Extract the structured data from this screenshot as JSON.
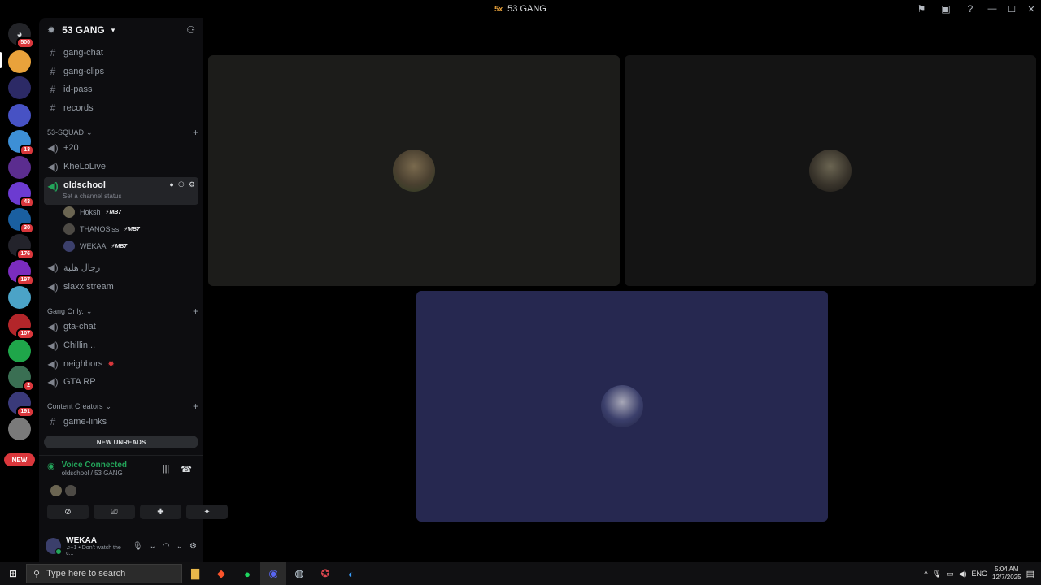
{
  "window": {
    "title": "53 GANG",
    "title_icon": "5x"
  },
  "rail": {
    "dm_badge": "500",
    "servers": [
      {
        "badge": "",
        "color": "#e9a23b"
      },
      {
        "badge": "",
        "color": "#2c2a66"
      },
      {
        "badge": "",
        "color": "#4752c4"
      },
      {
        "badge": "13",
        "color": "#3d8fd6"
      },
      {
        "badge": "",
        "color": "#5b2d8f"
      },
      {
        "badge": "43",
        "color": "#6c3bd1"
      },
      {
        "badge": "30",
        "color": "#1a5fa0"
      },
      {
        "badge": "176",
        "color": "#23232b"
      },
      {
        "badge": "197",
        "color": "#7b2cbf"
      },
      {
        "badge": "",
        "color": "#4ba3c7"
      },
      {
        "badge": "107",
        "color": "#b3262a"
      },
      {
        "badge": "",
        "color": "#1fa64a"
      },
      {
        "badge": "2",
        "color": "#3a6f53"
      },
      {
        "badge": "191",
        "color": "#3a3a7a"
      },
      {
        "badge": "",
        "color": "#7a7a7a"
      }
    ],
    "new_label": "NEW"
  },
  "sidebar": {
    "server_name": "53 GANG",
    "channels_top": [
      "gang-chat",
      "gang-clips",
      "id-pass",
      "records"
    ],
    "category_squad": "53-SQUAD",
    "squad_channels": [
      "+20",
      "KheLoLive"
    ],
    "active_channel": "oldschool",
    "active_status": "Set a channel status",
    "voice_users": [
      {
        "name": "Hoksh",
        "tag": "MB7"
      },
      {
        "name": "THANOS'ss",
        "tag": "MB7"
      },
      {
        "name": "WEKAA",
        "tag": "MB7"
      }
    ],
    "more_voice": [
      "رجال هلبة",
      "slaxx stream"
    ],
    "category_gang": "Gang Only.",
    "gang_channels": [
      "gta-chat",
      "Chillin...",
      "neighbors",
      "GTA RP"
    ],
    "category_creators": "Content Creators",
    "creator_channels": [
      "game-links"
    ],
    "new_unreads": "NEW UNREADS"
  },
  "voice": {
    "title": "Voice Connected",
    "subtitle": "oldschool / 53 GANG"
  },
  "user": {
    "name": "WEKAA",
    "status": "♫+1 • Don't watch the c..."
  },
  "taskbar": {
    "search_placeholder": "Type here to search",
    "lang": "ENG",
    "time": "5:04 AM",
    "date": "12/7/2025"
  }
}
